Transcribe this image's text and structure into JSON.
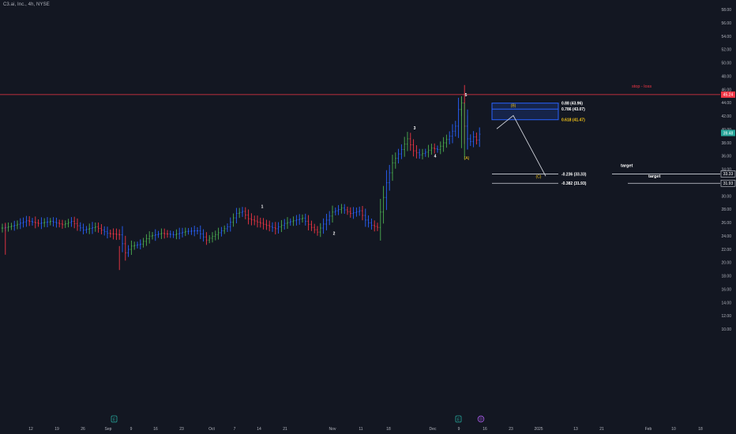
{
  "symbol_info": "C3.ai, Inc., 4h, NYSE",
  "price_axis": {
    "ticks": [
      "58.00",
      "56.00",
      "54.00",
      "52.00",
      "50.00",
      "48.00",
      "46.00",
      "44.00",
      "42.00",
      "40.00",
      "38.00",
      "36.00",
      "34.00",
      "32.00",
      "30.00",
      "28.00",
      "26.00",
      "24.00",
      "22.00",
      "20.00",
      "18.00",
      "16.00",
      "14.00",
      "12.00",
      "10.00"
    ],
    "stop_badge": "45.24",
    "current_badge": "39.48",
    "target1_badge": "33.33",
    "target2_badge": "31.93"
  },
  "time_axis": {
    "ticks": [
      "12",
      "19",
      "26",
      "Sep",
      "9",
      "16",
      "23",
      "Oct",
      "7",
      "14",
      "21",
      "Nov",
      "11",
      "18",
      "Dec",
      "9",
      "16",
      "23",
      "2025",
      "13",
      "21",
      "Feb",
      "10",
      "18"
    ]
  },
  "stop_loss": {
    "label": "stop - loss",
    "price": 45.24
  },
  "fib_box": {
    "wave_label": "(B)",
    "levels": [
      {
        "label": "0.88 (43.96)",
        "price": 43.96
      },
      {
        "label": "0.786 (43.07)",
        "price": 43.07
      },
      {
        "label": "0.618 (41.47)",
        "price": 41.47
      }
    ]
  },
  "targets": [
    {
      "fib_label": "-0.236 (33.33)",
      "text": "target",
      "price": 33.33
    },
    {
      "fib_label": "-0.382 (31.93)",
      "text": "target",
      "price": 31.93
    }
  ],
  "wave_labels": {
    "w1": "1",
    "w2": "2",
    "w3": "3",
    "w4": "4",
    "w5": "5",
    "wA": "(A)",
    "wC": "(C)"
  },
  "event_markers": [
    "E",
    "E",
    "D"
  ],
  "colors": {
    "background": "#131722",
    "up_bar": "#4caf50",
    "down_bar": "#f23645",
    "blue_bar": "#2962ff",
    "stop_line": "#f23645",
    "current_badge": "#26a69a",
    "fib_box": "#2962ff",
    "wave_yellow": "#f5c518",
    "event_earnings": "#26a69a",
    "event_dividend": "#b05ef5"
  },
  "chart_data": {
    "type": "ohlc",
    "title": "C3.ai, Inc., 4h, NYSE",
    "xlabel": "",
    "ylabel": "",
    "ylim": [
      9.5,
      59
    ],
    "x_ticks": [
      "12",
      "19",
      "26",
      "Sep",
      "9",
      "16",
      "23",
      "Oct",
      "7",
      "14",
      "21",
      "Nov",
      "11",
      "18",
      "Dec",
      "9",
      "16",
      "23",
      "2025",
      "13",
      "21",
      "Feb",
      "10",
      "18"
    ],
    "anchors": [
      [
        0,
        25.2
      ],
      [
        4,
        25.6
      ],
      [
        8,
        26.3
      ],
      [
        12,
        25.9
      ],
      [
        16,
        26.2
      ],
      [
        20,
        25.7
      ],
      [
        23,
        26.2
      ],
      [
        27,
        24.9
      ],
      [
        31,
        25.4
      ],
      [
        35,
        24.4
      ],
      [
        39,
        24.2
      ],
      [
        41,
        21.5
      ],
      [
        43,
        22.5
      ],
      [
        46,
        22.8
      ],
      [
        49,
        24.0
      ],
      [
        53,
        24.4
      ],
      [
        57,
        24.2
      ],
      [
        61,
        24.7
      ],
      [
        65,
        24.8
      ],
      [
        68,
        23.4
      ],
      [
        72,
        24.5
      ],
      [
        75,
        25.4
      ],
      [
        78,
        27.4
      ],
      [
        80,
        27.7
      ],
      [
        82,
        26.6
      ],
      [
        85,
        26.1
      ],
      [
        88,
        25.6
      ],
      [
        91,
        25.1
      ],
      [
        94,
        25.9
      ],
      [
        97,
        26.3
      ],
      [
        100,
        26.7
      ],
      [
        103,
        25.3
      ],
      [
        105,
        24.6
      ],
      [
        107,
        25.8
      ],
      [
        110,
        27.6
      ],
      [
        113,
        28.2
      ],
      [
        116,
        27.4
      ],
      [
        119,
        27.8
      ],
      [
        121,
        26.4
      ],
      [
        123,
        25.6
      ],
      [
        125,
        25.3
      ],
      [
        126,
        27.6
      ],
      [
        128,
        32.0
      ],
      [
        130,
        35.0
      ],
      [
        133,
        37.0
      ],
      [
        135,
        38.6
      ],
      [
        137,
        36.8
      ],
      [
        139,
        36.2
      ],
      [
        141,
        36.6
      ],
      [
        143,
        37.2
      ],
      [
        145,
        37.0
      ],
      [
        147,
        38.0
      ],
      [
        149,
        39.0
      ],
      [
        151,
        40.5
      ],
      [
        152,
        43.0
      ],
      [
        153,
        44.0
      ],
      [
        154,
        40.5
      ],
      [
        155,
        38.6
      ],
      [
        156,
        38.2
      ],
      [
        157,
        38.9
      ],
      [
        158,
        38.4
      ],
      [
        159,
        39.3
      ]
    ],
    "series": [
      {
        "name": "",
        "annotations": [
          {
            "label": "1",
            "price": 28.2
          },
          {
            "label": "2",
            "price": 24.2
          },
          {
            "label": "3",
            "price": 40.0
          },
          {
            "label": "4",
            "price": 35.8
          },
          {
            "label": "5",
            "price": 45.0
          },
          {
            "label": "(A)",
            "price": 35.5
          },
          {
            "label": "(C)",
            "price": 32.7
          }
        ]
      }
    ],
    "horizontal_lines": [
      45.24,
      33.33,
      31.93
    ],
    "fib_levels": [
      43.96,
      43.07,
      41.47
    ],
    "current_price": 39.48,
    "grid": false
  }
}
